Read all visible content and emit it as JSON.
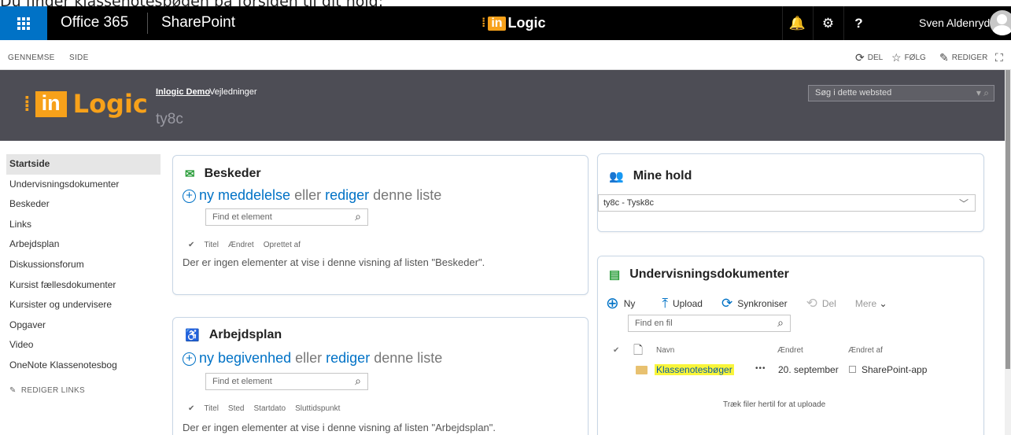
{
  "caption": "Du finder klassenotesbøgen på forsiden til dit hold:",
  "suitebar": {
    "office": "Office 365",
    "app": "SharePoint",
    "logo_in": "in",
    "logo_text": "Logic",
    "bell": "🔔",
    "gear": "⚙",
    "help": "?",
    "user": "Sven Aldenryd"
  },
  "ribbon": {
    "tabs": [
      "GENNEMSE",
      "SIDE"
    ],
    "del": "DEL",
    "folg": "FØLG",
    "rediger": "REDIGER"
  },
  "header": {
    "logo_in": "in",
    "logo_text": "Logic",
    "nav": [
      "Inlogic Demo",
      "Vejledninger"
    ],
    "site_title": "ty8c",
    "search_placeholder": "Søg i dette websted"
  },
  "leftnav": {
    "items": [
      "Startside",
      "Undervisningsdokumenter",
      "Beskeder",
      "Links",
      "Arbejdsplan",
      "Diskussionsforum",
      "Kursist fællesdokumenter",
      "Kursister og undervisere",
      "Opgaver",
      "Video",
      "OneNote Klassenotesbog"
    ],
    "edit_links": "REDIGER LINKS"
  },
  "beskeder": {
    "title": "Beskeder",
    "new_link": "ny meddelelse",
    "or": "eller",
    "edit_link": "rediger",
    "rest": "denne liste",
    "find": "Find et element",
    "cols": [
      "✔",
      "Titel",
      "Ændret",
      "Oprettet af"
    ],
    "empty": "Der er ingen elementer at vise i denne visning af listen \"Beskeder\"."
  },
  "arbejdsplan": {
    "title": "Arbejdsplan",
    "new_link": "ny begivenhed",
    "or": "eller",
    "edit_link": "rediger",
    "rest": "denne liste",
    "find": "Find et element",
    "cols": [
      "✔",
      "Titel",
      "Sted",
      "Startdato",
      "Sluttidspunkt"
    ],
    "empty": "Der er ingen elementer at vise i denne visning af listen \"Arbejdsplan\"."
  },
  "minehold": {
    "title": "Mine hold",
    "selected": "ty8c - Tysk8c"
  },
  "undervisning": {
    "title": "Undervisningsdokumenter",
    "ny": "Ny",
    "upload": "Upload",
    "sync": "Synkroniser",
    "del": "Del",
    "mere": "Mere",
    "find": "Find en fil",
    "cols": {
      "check": "✔",
      "navn": "Navn",
      "aendret": "Ændret",
      "aendret_af": "Ændret af"
    },
    "row": {
      "name": "Klassenotesbøger",
      "dots": "•••",
      "date": "20. september",
      "by": "SharePoint-app"
    },
    "drop": "Træk filer hertil for at uploade"
  },
  "colors": {
    "accent": "#0072c6",
    "brand": "#f7a11a",
    "header": "#4d4d55"
  }
}
